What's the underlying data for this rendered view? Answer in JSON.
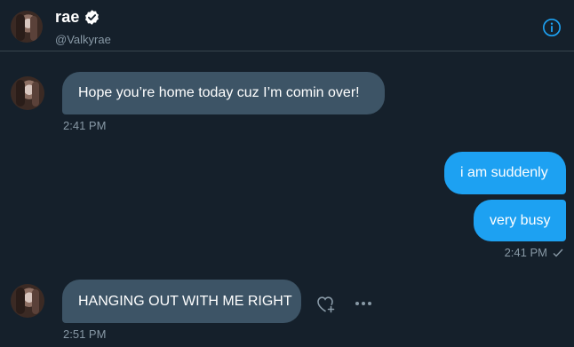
{
  "header": {
    "name": "rae",
    "handle": "@Valkyrae"
  },
  "messages": [
    {
      "direction": "received",
      "text": "Hope you’re home today cuz I’m comin over!",
      "time": "2:41 PM"
    },
    {
      "direction": "sent",
      "text": "i am suddenly"
    },
    {
      "direction": "sent",
      "text": "very busy",
      "time": "2:41 PM"
    },
    {
      "direction": "received",
      "text": "HANGING OUT WITH ME RIGHT",
      "time": "2:51 PM"
    }
  ],
  "icons": {
    "verified": "verified-badge-icon",
    "info": "info-icon",
    "read_receipt": "checkmark-icon",
    "react": "add-reaction-heart-icon",
    "more": "more-options-icon"
  },
  "colors": {
    "background": "#15202b",
    "received_bubble": "#3d5466",
    "sent_bubble": "#1da1f2",
    "secondary_text": "#8899a6",
    "accent": "#1da1f2"
  }
}
